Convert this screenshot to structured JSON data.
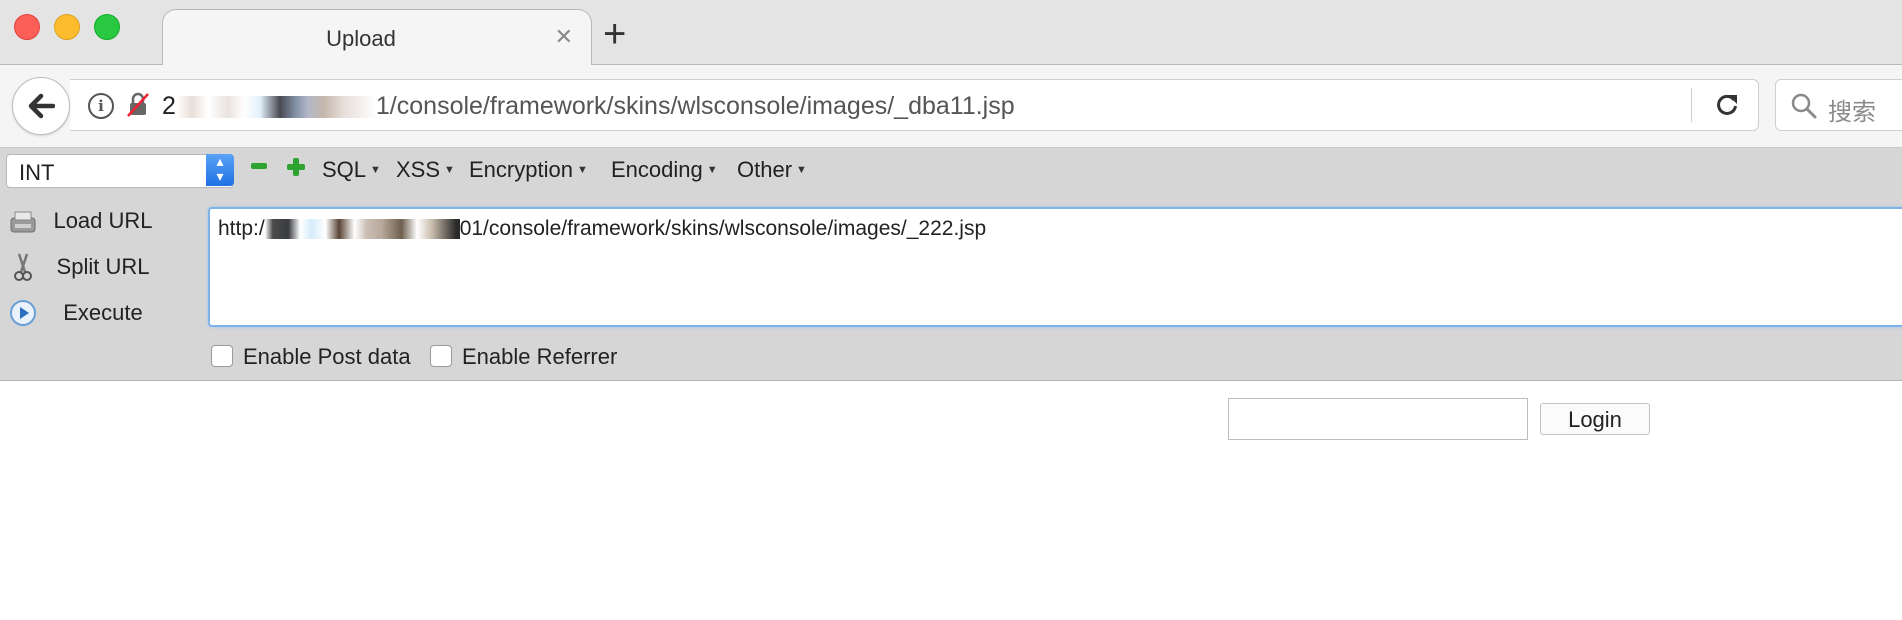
{
  "window": {
    "tab_title": "Upload",
    "tab_close": "✕",
    "new_tab": "+"
  },
  "nav": {
    "url_prefix": "2",
    "url_suffix": "1/console/framework/skins/wlsconsole/images/_dba11.jsp",
    "search_placeholder": "搜索"
  },
  "hackbar": {
    "select_value": "INT",
    "menus": [
      "SQL",
      "XSS",
      "Encryption",
      "Encoding",
      "Other"
    ],
    "buttons": {
      "load": "Load URL",
      "split": "Split URL",
      "execute": "Execute"
    },
    "url_field": {
      "prefix": "http:/",
      "suffix": "01/console/framework/skins/wlsconsole/images/_222.jsp"
    },
    "options": {
      "post": "Enable Post data",
      "referrer": "Enable Referrer"
    }
  },
  "page": {
    "login_label": "Login"
  }
}
